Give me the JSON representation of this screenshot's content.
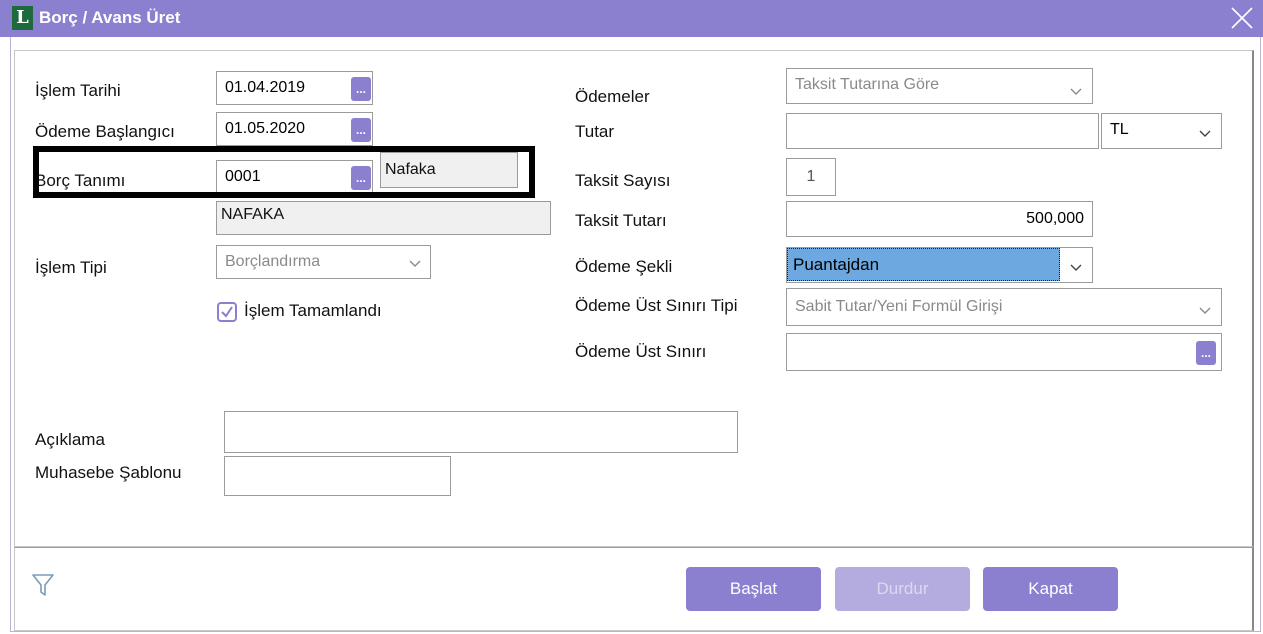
{
  "window": {
    "title": "Borç / Avans Üret",
    "logo_letter": "L"
  },
  "left": {
    "islem_tarihi": {
      "label": "İşlem Tarihi",
      "value": "01.04.2019"
    },
    "odeme_baslangici": {
      "label": "Ödeme Başlangıcı",
      "value": "01.05.2020"
    },
    "borc_tanimi": {
      "label": "Borç Tanımı",
      "code": "0001",
      "name": "Nafaka",
      "description": "NAFAKA"
    },
    "islem_tipi": {
      "label": "İşlem Tipi",
      "value": "Borçlandırma"
    },
    "islem_tamamlandi": {
      "label": "İşlem Tamamlandı",
      "checked": true
    },
    "aciklama": {
      "label": "Açıklama",
      "value": ""
    },
    "muhasebe_sablonu": {
      "label": "Muhasebe Şablonu",
      "value": ""
    }
  },
  "right": {
    "odemeler": {
      "label": "Ödemeler",
      "value": "Taksit Tutarına Göre"
    },
    "tutar": {
      "label": "Tutar",
      "value": "",
      "currency": "TL"
    },
    "taksit_sayisi": {
      "label": "Taksit Sayısı",
      "value": "1"
    },
    "taksit_tutari": {
      "label": "Taksit Tutarı",
      "value": "500,000"
    },
    "odeme_sekli": {
      "label": "Ödeme Şekli",
      "value": "Puantajdan"
    },
    "odeme_ust_siniri_tipi": {
      "label": "Ödeme Üst Sınırı Tipi",
      "value": "Sabit Tutar/Yeni Formül Girişi"
    },
    "odeme_ust_siniri": {
      "label": "Ödeme Üst Sınırı",
      "value": ""
    }
  },
  "buttons": {
    "start": "Başlat",
    "stop": "Durdur",
    "close": "Kapat",
    "dots": "..."
  },
  "icons": {
    "filter": "filter-icon",
    "close": "close-icon",
    "dropdown": "chevron-down-icon"
  },
  "colors": {
    "accent": "#8b7fd0",
    "selection": "#6da8e0"
  }
}
